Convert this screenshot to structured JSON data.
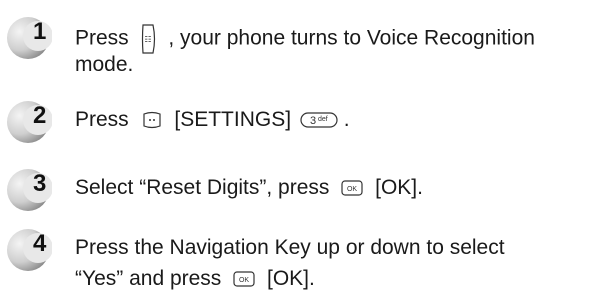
{
  "steps": [
    {
      "number": "1",
      "line1_prefix": "Press",
      "line1_suffix": ", your phone turns to Voice Recognition",
      "line2": "mode.",
      "key_icon": "voice-side-key-icon"
    },
    {
      "number": "2",
      "prefix": "Press",
      "middle": "[SETTINGS]",
      "suffix": ".",
      "key_icon_1": "right-soft-key-icon",
      "key_icon_2": "key-3-def-icon",
      "key_label_2": "def"
    },
    {
      "number": "3",
      "text": "Select “Reset Digits”, press",
      "suffix": "[OK].",
      "key_icon": "ok-key-icon"
    },
    {
      "number": "4",
      "line1": "Press the Navigation Key up or down to select",
      "line2_prefix": "“Yes” and press",
      "line2_suffix": "[OK].",
      "key_icon": "ok-key-icon"
    }
  ],
  "colors": {
    "badge_light": "#f2f2f2",
    "badge_dark": "#8a8a8a",
    "text": "#1a1a1a"
  }
}
